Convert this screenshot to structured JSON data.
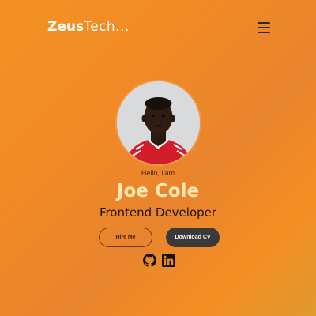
{
  "nav": {
    "brand_bold": "Zeus",
    "brand_light": "Tech...",
    "menu_icon": "hamburger-menu-icon"
  },
  "hero": {
    "avatar_alt": "Profile photo",
    "greeting": "Hello, I'am",
    "name": "Joe Cole",
    "role": "Frontend Developer",
    "buttons": {
      "hire": "Hire Me",
      "cv": "Download CV"
    },
    "social": [
      {
        "icon": "github-icon"
      },
      {
        "icon": "linkedin-icon"
      }
    ]
  },
  "colors": {
    "background": "#f28a24",
    "name": "#fde5b0",
    "dark_button": "#3a3a3a"
  }
}
